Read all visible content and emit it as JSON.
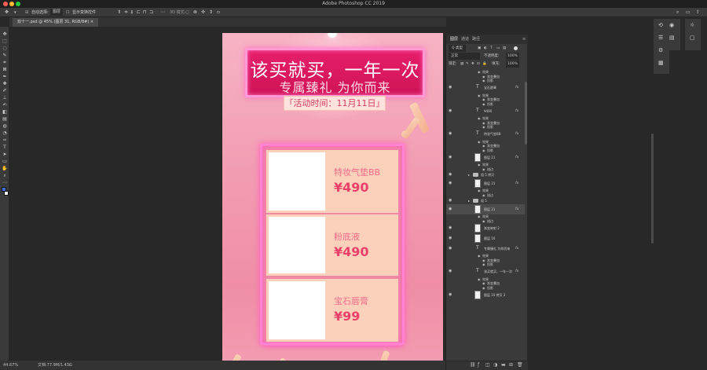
{
  "app": {
    "title": "Adobe Photoshop CC 2019",
    "traffic_colors": [
      "#fe5f57",
      "#febc2e",
      "#28c840"
    ]
  },
  "options_bar": {
    "auto_select_label": "自动选择:",
    "auto_select_value": "图层",
    "transform_controls_label": "显示变换控件",
    "mode_3d_label": "3D 模式:"
  },
  "document": {
    "tab_title": "双十一.psd @ 45% (图层 31, RGB/8#)"
  },
  "status": {
    "zoom": "44.67%",
    "doc_size": "文档:77.9M/1.43G"
  },
  "artwork": {
    "headline": "该买就买，一年一次",
    "subheadline": "专属臻礼 为你而来",
    "date_label": "「活动时间：11月11日」",
    "products": [
      {
        "name": "特妆气垫BB",
        "price": "¥490"
      },
      {
        "name": "粉底液",
        "price": "¥490"
      },
      {
        "name": "宝石唇膏",
        "price": "¥99"
      }
    ],
    "colors": {
      "background": "#f29db3",
      "banner": "#dd1a63",
      "neon": "#ff83d0",
      "card": "#fbd1bb",
      "price": "#ea3f6a"
    }
  },
  "layers_panel": {
    "tabs": [
      "图层",
      "通道",
      "路径"
    ],
    "filter_label": "Q 类型",
    "blend_mode": "正常",
    "opacity_label": "不透明度:",
    "opacity_value": "100%",
    "lock_label": "锁定:",
    "fill_label": "填充:",
    "fill_value": "100%",
    "fx_label": "fx",
    "layers": [
      {
        "kind": "effect",
        "text": "效果",
        "indent": 1
      },
      {
        "kind": "effect",
        "text": "渐变叠加",
        "indent": 2
      },
      {
        "kind": "effect",
        "text": "投影",
        "indent": 2
      },
      {
        "kind": "text",
        "name": "宝石唇膏",
        "fx": true
      },
      {
        "kind": "effect",
        "text": "效果",
        "indent": 1
      },
      {
        "kind": "effect",
        "text": "渐变叠加",
        "indent": 2
      },
      {
        "kind": "effect",
        "text": "投影",
        "indent": 2
      },
      {
        "kind": "text",
        "name": "¥490",
        "fx": true
      },
      {
        "kind": "effect",
        "text": "效果",
        "indent": 1
      },
      {
        "kind": "effect",
        "text": "渐变叠加",
        "indent": 2
      },
      {
        "kind": "effect",
        "text": "投影",
        "indent": 2
      },
      {
        "kind": "text",
        "name": "特妆气垫BB",
        "fx": true
      },
      {
        "kind": "effect",
        "text": "效果",
        "indent": 1
      },
      {
        "kind": "effect",
        "text": "渐变叠加",
        "indent": 2
      },
      {
        "kind": "effect",
        "text": "投影",
        "indent": 2
      },
      {
        "kind": "image",
        "name": "图层 21",
        "fx": true
      },
      {
        "kind": "effect",
        "text": "效果",
        "indent": 1
      },
      {
        "kind": "effect",
        "text": "描边",
        "indent": 2
      },
      {
        "kind": "group",
        "name": "组 5 拷贝"
      },
      {
        "kind": "image",
        "name": "图层 31",
        "fx": true
      },
      {
        "kind": "effect",
        "text": "效果",
        "indent": 1
      },
      {
        "kind": "effect",
        "text": "描边",
        "indent": 2
      },
      {
        "kind": "group",
        "name": "组 5"
      },
      {
        "kind": "image",
        "name": "图层 31",
        "fx": true,
        "selected": true
      },
      {
        "kind": "effect",
        "text": "效果",
        "indent": 1
      },
      {
        "kind": "effect",
        "text": "描边",
        "indent": 2
      },
      {
        "kind": "image",
        "name": "渐变映射 2",
        "fx": false
      },
      {
        "kind": "image",
        "name": "图层 16",
        "fx": false
      },
      {
        "kind": "text",
        "name": "专属臻礼 为你而来",
        "fx": true
      },
      {
        "kind": "effect",
        "text": "效果",
        "indent": 1
      },
      {
        "kind": "effect",
        "text": "渐变叠加",
        "indent": 2
      },
      {
        "kind": "effect",
        "text": "投影",
        "indent": 2
      },
      {
        "kind": "text",
        "name": "该买就买，一年一次",
        "fx": true
      },
      {
        "kind": "effect",
        "text": "效果",
        "indent": 1
      },
      {
        "kind": "effect",
        "text": "渐变叠加",
        "indent": 2
      },
      {
        "kind": "effect",
        "text": "投影",
        "indent": 2
      },
      {
        "kind": "image",
        "name": "图层 10 拷贝 2",
        "fx": false
      }
    ]
  }
}
